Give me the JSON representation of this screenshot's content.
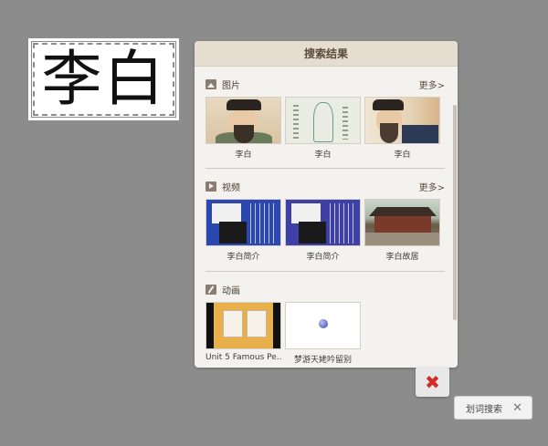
{
  "selected_text": "李白",
  "panel": {
    "title": "搜索结果"
  },
  "sections": {
    "images": {
      "label": "图片",
      "icon": "image-icon",
      "more": "更多>",
      "items": [
        {
          "caption": "李白"
        },
        {
          "caption": "李白"
        },
        {
          "caption": "李白"
        }
      ]
    },
    "videos": {
      "label": "视频",
      "icon": "video-icon",
      "more": "更多>",
      "items": [
        {
          "caption": "李白简介"
        },
        {
          "caption": "李白简介"
        },
        {
          "caption": "李白故居"
        }
      ]
    },
    "animations": {
      "label": "动画",
      "icon": "animation-icon",
      "items": [
        {
          "caption": "Unit 5 Famous Pe..."
        },
        {
          "caption": "梦游天姥吟留别"
        }
      ]
    }
  },
  "close_button": {
    "icon": "close-icon",
    "color": "#d32a2a"
  },
  "word_lookup": {
    "label": "划词搜索",
    "close_icon": "close-icon"
  },
  "colors": {
    "background": "#8c8c8c",
    "panel_header": "#e6ddd1",
    "panel_body": "#f4f2ef"
  }
}
